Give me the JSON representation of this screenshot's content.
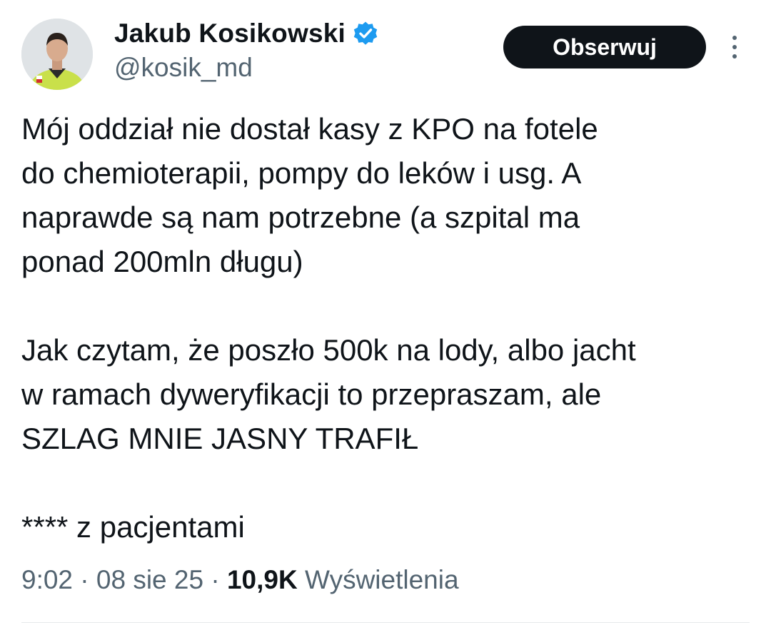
{
  "author": {
    "display_name": "Jakub Kosikowski",
    "handle": "@kosik_md",
    "verified": true,
    "verified_color": "#1d9bf0"
  },
  "actions": {
    "follow_label": "Obserwuj",
    "more_icon": "more-vertical-icon"
  },
  "tweet": {
    "lines": [
      "Mój oddział nie dostał kasy z KPO na fotele",
      "do chemioterapii, pompy do leków i usg. A",
      "naprawde są nam potrzebne (a szpital ma",
      "ponad 200mln długu)",
      "",
      "Jak czytam, że poszło 500k na lody, albo jacht",
      "w ramach dyweryfikacji to przepraszam, ale",
      "SZLAG MNIE JASNY TRAFIŁ",
      "",
      "**** z pacjentami"
    ]
  },
  "meta": {
    "time": "9:02",
    "separator": " · ",
    "date": "08 sie 25",
    "views_count": "10,9K",
    "views_label": "Wyświetlenia"
  },
  "colors": {
    "text_primary": "#0f1419",
    "text_secondary": "#536471",
    "button_bg": "#0f1419",
    "button_text": "#ffffff"
  }
}
